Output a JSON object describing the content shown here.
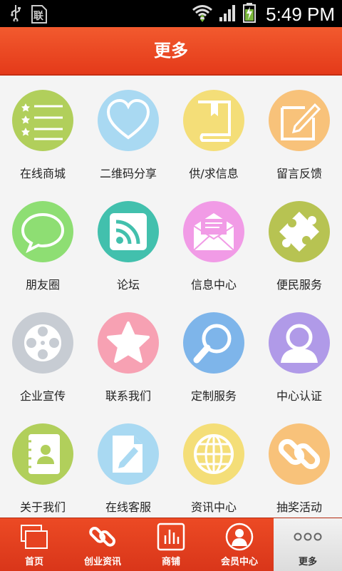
{
  "status_bar": {
    "time": "5:49 PM",
    "carrier_glyph": "联"
  },
  "header": {
    "title": "更多"
  },
  "grid": {
    "items": [
      {
        "label": "在线商城",
        "icon": "list-stars-icon",
        "color": "#b1cf5b"
      },
      {
        "label": "二维码分享",
        "icon": "heart-icon",
        "color": "#a9d9f2"
      },
      {
        "label": "供/求信息",
        "icon": "book-icon",
        "color": "#f4de78"
      },
      {
        "label": "留言反馈",
        "icon": "edit-icon",
        "color": "#f8c27a"
      },
      {
        "label": "朋友圈",
        "icon": "speech-bubble-icon",
        "color": "#8ede73"
      },
      {
        "label": "论坛",
        "icon": "rss-icon",
        "color": "#42c0ad"
      },
      {
        "label": "信息中心",
        "icon": "mail-icon",
        "color": "#f19be6"
      },
      {
        "label": "便民服务",
        "icon": "puzzle-icon",
        "color": "#b7c352"
      },
      {
        "label": "企业宣传",
        "icon": "film-reel-icon",
        "color": "#c7ccd3"
      },
      {
        "label": "联系我们",
        "icon": "star-icon",
        "color": "#f7a1b3"
      },
      {
        "label": "定制服务",
        "icon": "magnifier-icon",
        "color": "#7eb5ea"
      },
      {
        "label": "中心认证",
        "icon": "user-icon",
        "color": "#b09ae8"
      },
      {
        "label": "关于我们",
        "icon": "contacts-book-icon",
        "color": "#b1cf5b"
      },
      {
        "label": "在线客服",
        "icon": "document-pencil-icon",
        "color": "#a9d9f2"
      },
      {
        "label": "资讯中心",
        "icon": "globe-icon",
        "color": "#f4de78"
      },
      {
        "label": "抽奖活动",
        "icon": "chain-link-icon",
        "color": "#f8c27a"
      }
    ]
  },
  "tabbar": {
    "tabs": [
      {
        "label": "首页",
        "icon": "home-windows-icon"
      },
      {
        "label": "创业资讯",
        "icon": "chain-link-icon"
      },
      {
        "label": "商铺",
        "icon": "bar-chart-icon"
      },
      {
        "label": "会员中心",
        "icon": "user-avatar-icon"
      },
      {
        "label": "更多",
        "icon": "more-dots-icon",
        "active": true
      }
    ]
  }
}
